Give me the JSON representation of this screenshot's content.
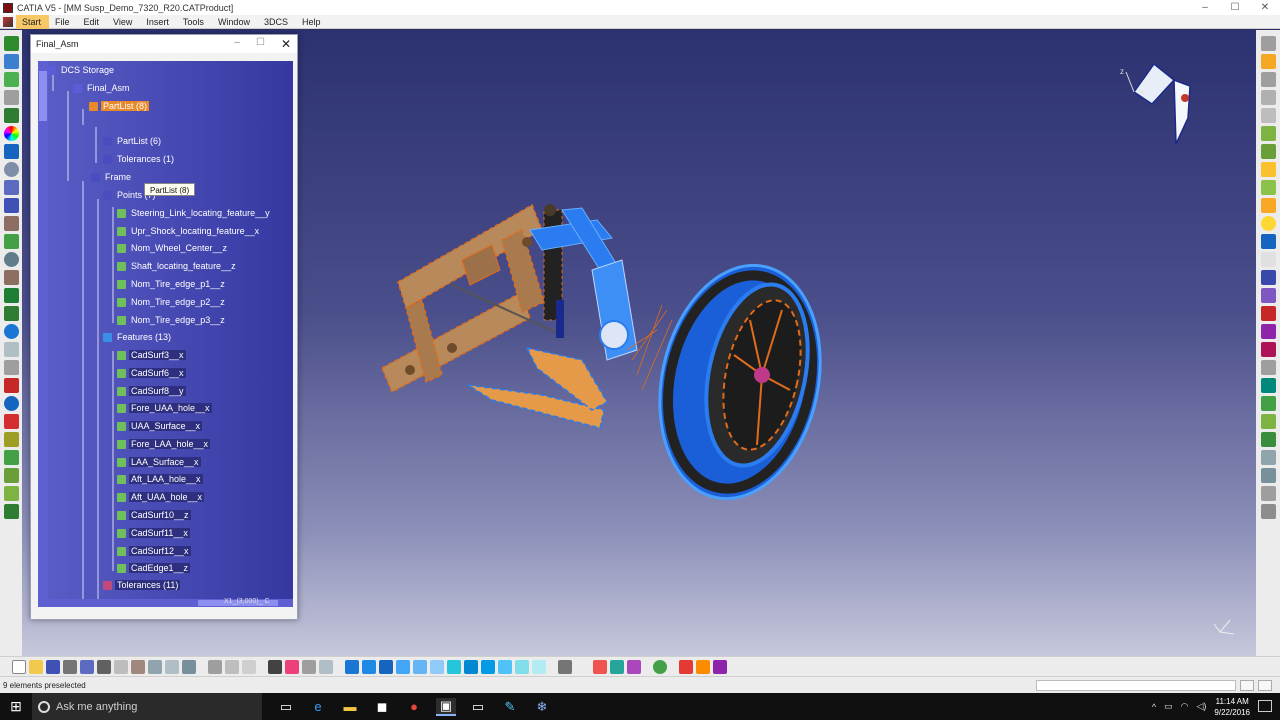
{
  "window": {
    "title": "CATIA V5 - [MM Susp_Demo_7320_R20.CATProduct]",
    "controls": [
      "–",
      "☐",
      "✕"
    ]
  },
  "menu": {
    "items": [
      "Start",
      "File",
      "Edit",
      "View",
      "Insert",
      "Tools",
      "Window",
      "3DCS",
      "Help"
    ],
    "active": "Start"
  },
  "tree_window": {
    "title": "Final_Asm",
    "tooltip": "PartList (8)",
    "hscroll_text": "X1_(3,000)_ C",
    "nodes": [
      "DCS Storage",
      "Final_Asm",
      "PartList (8)",
      "PartList (6)",
      "Tolerances (1)",
      "Frame",
      "Points (7)",
      "Steering_Link_locating_feature__y",
      "Upr_Shock_locating_feature__x",
      "Nom_Wheel_Center__z",
      "Shaft_locating_feature__z",
      "Nom_Tire_edge_p1__z",
      "Nom_Tire_edge_p2__z",
      "Nom_Tire_edge_p3__z",
      "Features (13)",
      "CadSurf3__x",
      "CadSurf6__x",
      "CadSurf8__y",
      "Fore_UAA_hole__x",
      "UAA_Surface__x",
      "Fore_LAA_hole__x",
      "LAA_Surface__x",
      "Aft_LAA_hole__x",
      "Aft_UAA_hole__x",
      "CadSurf10__z",
      "CadSurf11__x",
      "CadSurf12__x",
      "CadEdge1__z",
      "Tolerances (11)"
    ]
  },
  "status": {
    "message": "9 elements preselected"
  },
  "taskbar": {
    "search_placeholder": "Ask me anything",
    "time": "11:14 AM",
    "date": "9/22/2016"
  },
  "colors": {
    "viewport_top": "#2c3170",
    "viewport_bottom": "#c6c8dc",
    "highlight": "#e88a2a",
    "part_blue": "#2a7cf0",
    "part_tan": "#b8895a"
  }
}
